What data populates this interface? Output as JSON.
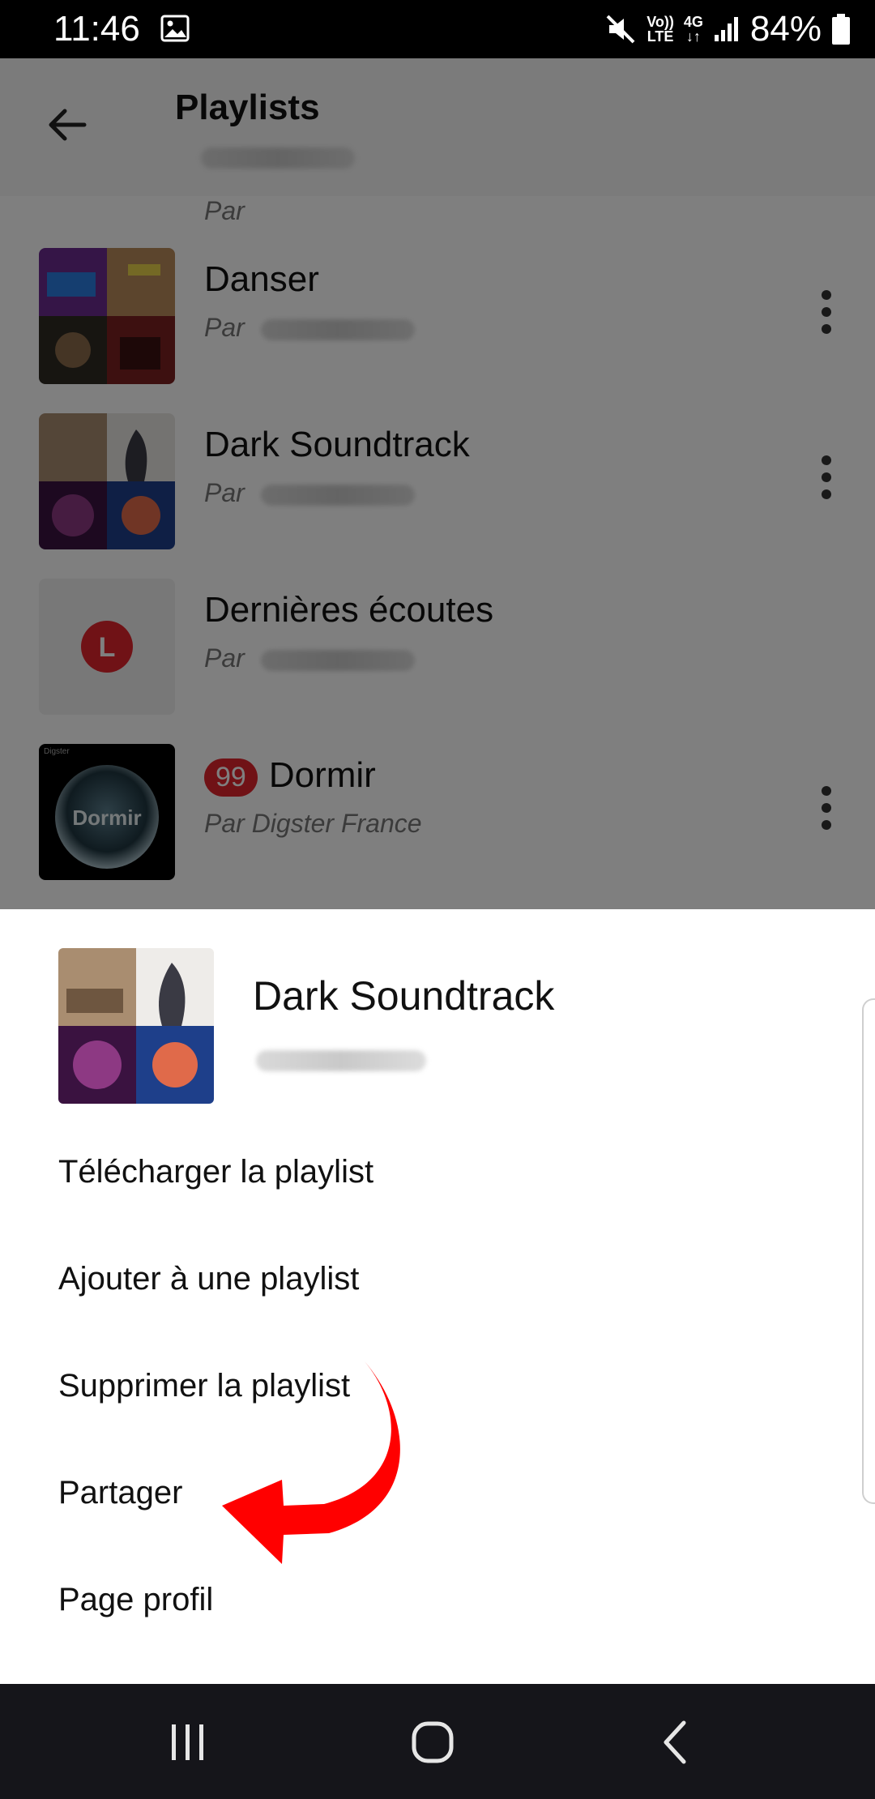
{
  "status_bar": {
    "time": "11:46",
    "volte": "Vo))",
    "lte": "LTE",
    "network": "4G",
    "battery": "84%",
    "icons": [
      "image-icon",
      "mute-icon",
      "volte-icon",
      "4g-icon",
      "signal-icon",
      "battery-icon"
    ]
  },
  "header": {
    "title": "Playlists",
    "back_icon": "arrow-left-icon"
  },
  "partial_row": {
    "par": "Par"
  },
  "playlists": [
    {
      "title": "Danser",
      "by_prefix": "Par",
      "by_name": "",
      "badge": ""
    },
    {
      "title": "Dark Soundtrack",
      "by_prefix": "Par",
      "by_name": "",
      "badge": ""
    },
    {
      "title": "Dernières écoutes",
      "by_prefix": "Par",
      "by_name": "",
      "badge": "",
      "thumb_letter": "L"
    },
    {
      "title": "Dormir",
      "by_prefix": "Par Digster France",
      "by_name": "",
      "badge": "99",
      "thumb_label": "Dormir",
      "thumb_brand": "Digster"
    }
  ],
  "sheet": {
    "title": "Dark Soundtrack",
    "menu": [
      "Télécharger la playlist",
      "Ajouter à une playlist",
      "Supprimer la playlist",
      "Partager",
      "Page profil"
    ]
  },
  "colors": {
    "accent": "#e0242d",
    "annotation_arrow": "#ff0000",
    "navbar": "#15151a"
  },
  "nav": [
    "recents-icon",
    "home-icon",
    "back-icon"
  ]
}
